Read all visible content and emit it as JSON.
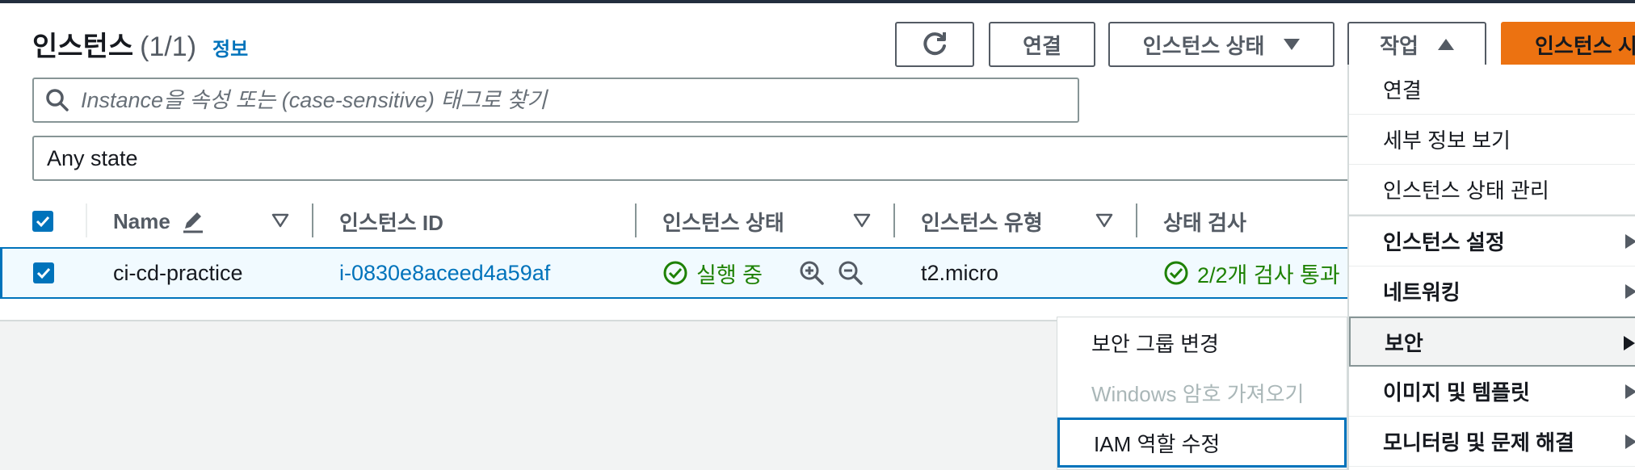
{
  "header": {
    "title": "인스턴스",
    "count": "(1/1)",
    "info_link": "정보"
  },
  "toolbar": {
    "refresh_icon": "refresh-icon",
    "connect_label": "연결",
    "instance_state_label": "인스턴스 상태",
    "actions_label": "작업",
    "launch_label": "인스턴스 시작"
  },
  "search": {
    "placeholder": "Instance을 속성 또는 (case-sensitive) 태그로 찾기"
  },
  "filter": {
    "selected": "Any state"
  },
  "table": {
    "columns": [
      "Name",
      "인스턴스 ID",
      "인스턴스 상태",
      "인스턴스 유형",
      "상태 검사"
    ],
    "rows": [
      {
        "name": "ci-cd-practice",
        "instance_id": "i-0830e8aceed4a59af",
        "state": "실행 중",
        "type": "t2.micro",
        "status_check": "2/2개 검사 통과"
      }
    ]
  },
  "actions_menu": {
    "items": [
      "연결",
      "세부 정보 보기",
      "인스턴스 상태 관리",
      "인스턴스 설정",
      "네트워킹",
      "보안",
      "이미지 및 템플릿",
      "모니터링 및 문제 해결"
    ]
  },
  "security_submenu": {
    "items": [
      "보안 그룹 변경",
      "Windows 암호 가져오기",
      "IAM 역할 수정"
    ]
  },
  "colors": {
    "accent": "#0073bb",
    "success": "#1d8102",
    "primary_button": "#ec7211"
  }
}
